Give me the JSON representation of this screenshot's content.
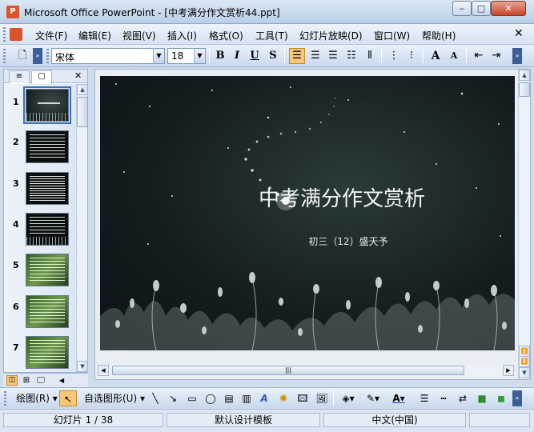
{
  "window": {
    "app_icon_label": "P",
    "title": "Microsoft Office PowerPoint - [中考满分作文赏析44.ppt]",
    "minimize": "‒",
    "maximize": "□",
    "close": "✕"
  },
  "menu": {
    "items": [
      "文件(F)",
      "编辑(E)",
      "视图(V)",
      "插入(I)",
      "格式(O)",
      "工具(T)",
      "幻灯片放映(D)",
      "窗口(W)",
      "帮助(H)"
    ]
  },
  "formatting": {
    "font": "宋体",
    "size": "18",
    "bold": "B",
    "italic": "I",
    "underline": "U",
    "shadow": "S",
    "grow_font": "A",
    "shrink_font": "A"
  },
  "outline_panel": {
    "tabs": [
      "≡",
      "▢"
    ],
    "close": "✕",
    "slides": [
      {
        "num": "1",
        "selected": true,
        "theme": "night"
      },
      {
        "num": "2",
        "selected": false,
        "theme": "text"
      },
      {
        "num": "3",
        "selected": false,
        "theme": "text"
      },
      {
        "num": "4",
        "selected": false,
        "theme": "text"
      },
      {
        "num": "5",
        "selected": false,
        "theme": "green"
      },
      {
        "num": "6",
        "selected": false,
        "theme": "green"
      },
      {
        "num": "7",
        "selected": false,
        "theme": "green"
      }
    ]
  },
  "slide": {
    "title": "中考满分作文赏析",
    "subtitle": "初三（12）盛天予"
  },
  "drawing": {
    "draw_menu": "绘图(R)",
    "autoshapes": "自选图形(U)"
  },
  "status": {
    "slide_pos": "幻灯片 1 / 38",
    "template": "默认设计模板",
    "language": "中文(中国)"
  }
}
